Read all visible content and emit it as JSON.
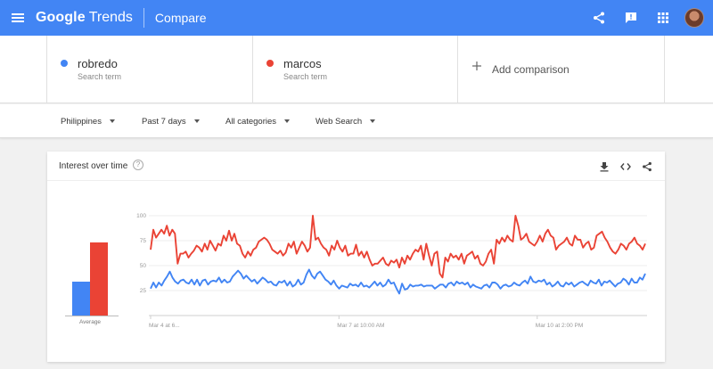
{
  "appbar": {
    "logo_google": "Google",
    "logo_trends": "Trends",
    "title": "Compare",
    "icons": [
      "menu-icon",
      "share-icon",
      "feedback-icon",
      "apps-icon"
    ]
  },
  "terms": [
    {
      "name": "robredo",
      "sub": "Search term",
      "color": "#4285f4"
    },
    {
      "name": "marcos",
      "sub": "Search term",
      "color": "#ea4335"
    }
  ],
  "add_comparison": "Add comparison",
  "filters": {
    "region": "Philippines",
    "time": "Past 7 days",
    "category": "All categories",
    "search_type": "Web Search"
  },
  "card": {
    "title": "Interest over time",
    "help": "?",
    "average_label": "Average",
    "actions": [
      "download-icon",
      "embed-icon",
      "share-icon"
    ]
  },
  "chart_data": {
    "type": "line",
    "ylim": [
      0,
      100
    ],
    "y_ticks": [
      "100",
      "75",
      "50",
      "25"
    ],
    "x_ticks": [
      "Mar 4 at 6...",
      "Mar 7 at 10:00 AM",
      "Mar 10 at 2:00 PM"
    ],
    "average": {
      "robredo": 32,
      "marcos": 68
    },
    "series": [
      {
        "name": "robredo",
        "color": "#4285f4",
        "values": [
          27,
          33,
          28,
          33,
          30,
          35,
          39,
          44,
          38,
          34,
          32,
          35,
          36,
          33,
          32,
          36,
          31,
          36,
          30,
          35,
          36,
          31,
          34,
          35,
          34,
          38,
          33,
          36,
          33,
          34,
          39,
          42,
          45,
          42,
          37,
          40,
          37,
          34,
          36,
          32,
          35,
          38,
          36,
          33,
          34,
          31,
          30,
          34,
          33,
          35,
          30,
          34,
          29,
          31,
          36,
          31,
          33,
          41,
          46,
          40,
          37,
          42,
          44,
          40,
          36,
          34,
          31,
          35,
          30,
          27,
          30,
          29,
          28,
          32,
          30,
          31,
          29,
          33,
          29,
          30,
          28,
          31,
          34,
          30,
          33,
          29,
          31,
          36,
          32,
          33,
          27,
          22,
          32,
          26,
          27,
          31,
          29,
          30,
          30,
          31,
          29,
          30,
          30,
          30,
          27,
          29,
          31,
          31,
          28,
          32,
          33,
          30,
          34,
          32,
          33,
          31,
          33,
          28,
          31,
          29,
          28,
          27,
          30,
          31,
          28,
          33,
          33,
          31,
          27,
          30,
          31,
          29,
          30,
          33,
          31,
          30,
          33,
          35,
          32,
          39,
          34,
          33,
          35,
          34,
          36,
          31,
          33,
          29,
          31,
          34,
          30,
          29,
          33,
          31,
          33,
          29,
          31,
          33,
          34,
          32,
          30,
          35,
          33,
          32,
          36,
          30,
          34,
          33,
          35,
          32,
          29,
          32,
          33,
          37,
          35,
          31,
          37,
          33,
          33,
          38,
          36,
          42
        ]
      },
      {
        "name": "marcos",
        "color": "#ea4335",
        "values": [
          66,
          86,
          78,
          82,
          86,
          82,
          90,
          80,
          86,
          82,
          52,
          62,
          62,
          64,
          58,
          62,
          65,
          70,
          68,
          64,
          72,
          66,
          75,
          70,
          65,
          72,
          70,
          80,
          75,
          85,
          75,
          82,
          72,
          70,
          62,
          58,
          64,
          60,
          66,
          68,
          74,
          76,
          78,
          76,
          72,
          66,
          64,
          62,
          65,
          60,
          63,
          72,
          68,
          74,
          62,
          68,
          74,
          70,
          64,
          68,
          100,
          76,
          78,
          72,
          68,
          66,
          60,
          70,
          66,
          75,
          68,
          64,
          70,
          60,
          62,
          62,
          71,
          60,
          64,
          58,
          64,
          56,
          50,
          52,
          52,
          55,
          58,
          52,
          50,
          55,
          53,
          56,
          48,
          58,
          52,
          60,
          56,
          62,
          66,
          64,
          70,
          56,
          72,
          60,
          50,
          62,
          64,
          42,
          38,
          58,
          54,
          62,
          58,
          60,
          56,
          62,
          52,
          60,
          62,
          64,
          57,
          60,
          52,
          50,
          54,
          62,
          66,
          52,
          76,
          72,
          78,
          74,
          80,
          76,
          74,
          100,
          90,
          76,
          78,
          82,
          74,
          72,
          70,
          74,
          80,
          74,
          82,
          86,
          80,
          78,
          66,
          70,
          72,
          74,
          78,
          72,
          70,
          80,
          76,
          76,
          68,
          72,
          74,
          66,
          68,
          80,
          82,
          84,
          78,
          74,
          68,
          64,
          62,
          66,
          72,
          70,
          66,
          72,
          74,
          78,
          72,
          70,
          66,
          72
        ]
      }
    ]
  }
}
